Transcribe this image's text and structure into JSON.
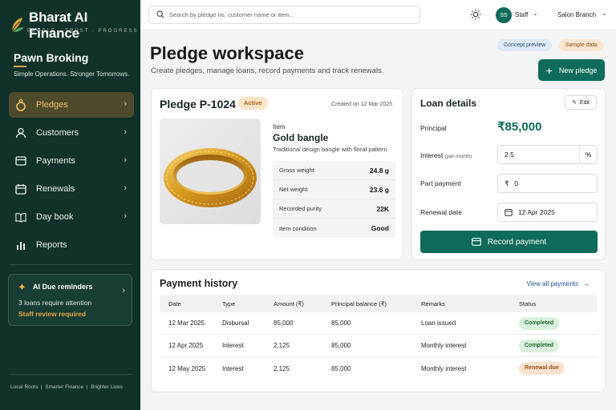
{
  "brand": {
    "name": "Bharat AI Finance",
    "tagline": "PEOPLE · TRUST · PROGRESS"
  },
  "sidebar": {
    "section_title": "Pawn Broking",
    "section_sub": "Simple Operations. Stronger Tomorrows.",
    "items": [
      {
        "label": "Pledges",
        "icon": "ring-icon",
        "active": true
      },
      {
        "label": "Customers",
        "icon": "user-icon"
      },
      {
        "label": "Payments",
        "icon": "card-icon"
      },
      {
        "label": "Renewals",
        "icon": "calendar-icon"
      },
      {
        "label": "Day book",
        "icon": "book-icon"
      },
      {
        "label": "Reports",
        "icon": "bar-chart-icon"
      }
    ],
    "ai": {
      "title": "AI Due reminders",
      "message": "3 loans require attention",
      "review": "Staff review required"
    },
    "footer": "Local Roots  |  Smarter Finance  |  Brighter Lives"
  },
  "topbar": {
    "search_placeholder": "Search by pledge no, customer name or item...",
    "avatar_initials": "SS",
    "user": "Staff",
    "branch": "Salon Branch"
  },
  "header": {
    "tags": {
      "concept": "Concept preview",
      "sample": "Sample data"
    },
    "title": "Pledge workspace",
    "subtitle": "Create pledges, manage loans, record payments and track renewals.",
    "new_button": "New pledge"
  },
  "pledge": {
    "id": "Pledge P-1024",
    "status": "Active",
    "created": "Created on 12 Mar 2025",
    "item_label": "Item",
    "item_name": "Gold bangle",
    "item_desc": "Traditional design bangle with floral pattern",
    "specs": [
      {
        "label": "Gross weight",
        "value": "24.8 g"
      },
      {
        "label": "Net weight",
        "value": "23.6 g"
      },
      {
        "label": "Recorded purity",
        "value": "22K"
      },
      {
        "label": "Item condition",
        "value": "Good"
      }
    ]
  },
  "loan": {
    "title": "Loan details",
    "edit": "Edit",
    "principal_label": "Principal",
    "principal_value": "₹85,000",
    "interest_label": "Interest",
    "interest_note": "(per month)",
    "interest_value": "2.5",
    "interest_suffix": "%",
    "part_label": "Part payment",
    "part_prefix": "₹",
    "part_value": "0",
    "renewal_label": "Renewal date",
    "renewal_value": "12 Apr 2025",
    "record_button": "Record payment"
  },
  "history": {
    "title": "Payment history",
    "view_all": "View all payments",
    "columns": [
      "Date",
      "Type",
      "Amount (₹)",
      "Principal balance (₹)",
      "Remarks",
      "Status"
    ],
    "rows": [
      {
        "date": "12 Mar 2025",
        "type": "Disbursal",
        "amount": "85,000",
        "balance": "85,000",
        "remarks": "Loan issued",
        "status": "Completed"
      },
      {
        "date": "12 Apr 2025",
        "type": "Interest",
        "amount": "2,125",
        "balance": "85,000",
        "remarks": "Monthly interest",
        "status": "Completed"
      },
      {
        "date": "12 May 2025",
        "type": "Interest",
        "amount": "2,125",
        "balance": "85,000",
        "remarks": "Monthly interest",
        "status": "Renewal due"
      }
    ]
  },
  "colors": {
    "sidebar": "#10322a",
    "accent": "#0f6b5a",
    "gold": "#e2a43c"
  }
}
